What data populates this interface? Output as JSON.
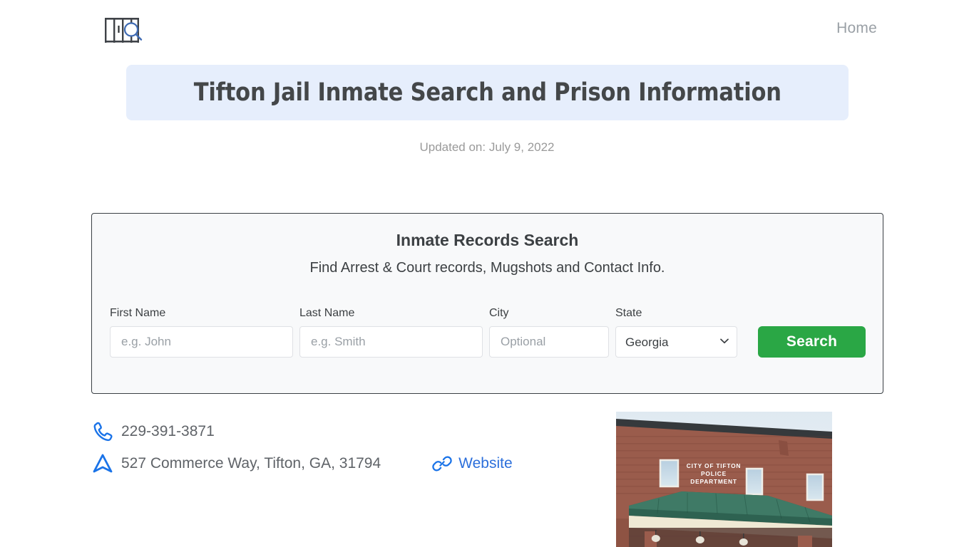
{
  "header": {
    "logo_icon": "jail-bars-magnifier-logo",
    "nav": [
      {
        "label": "Home",
        "name": "nav-home"
      }
    ]
  },
  "hero": {
    "title": "Tifton Jail Inmate Search and Prison Information",
    "updated": "Updated on: July 9, 2022",
    "banner_color": "#e6eefc",
    "title_color": "#444749"
  },
  "search_card": {
    "title": "Inmate Records Search",
    "subtitle": "Find Arrest & Court records, Mugshots and Contact Info.",
    "fields": {
      "first_name": {
        "label": "First Name",
        "placeholder": "e.g. John",
        "value": ""
      },
      "last_name": {
        "label": "Last Name",
        "placeholder": "e.g. Smith",
        "value": ""
      },
      "city": {
        "label": "City",
        "placeholder": "Optional",
        "value": ""
      },
      "state": {
        "label": "State",
        "selected": "Georgia",
        "options": [
          "Georgia"
        ]
      }
    },
    "search_button": "Search",
    "search_button_color": "#2aa745"
  },
  "contact": {
    "phone": {
      "icon": "phone-icon",
      "text": "229-391-3871"
    },
    "address": {
      "icon": "navigation-arrow-icon",
      "text": "527 Commerce Way, Tifton, GA, 31794"
    },
    "website": {
      "icon": "link-icon",
      "label": "Website",
      "color": "#2c6fdb"
    }
  },
  "photo": {
    "name": "tifton-police-department-photo",
    "sign_line1": "CITY OF TIFTON",
    "sign_line2": "POLICE",
    "sign_line3": "DEPARTMENT"
  }
}
